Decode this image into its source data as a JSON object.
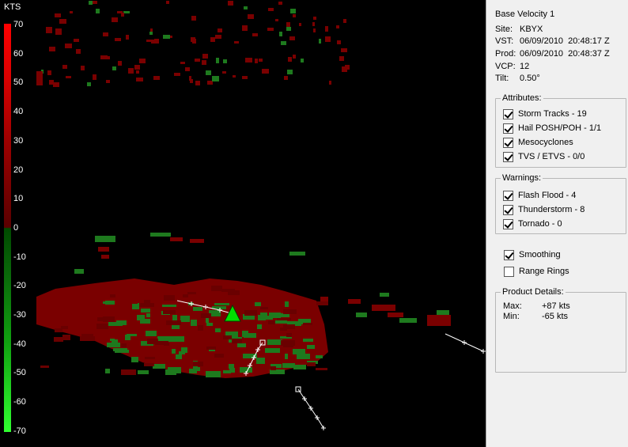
{
  "colors": {
    "velocity_outbound": "#7a0000",
    "velocity_inbound": "#1e7a1e",
    "storm_marker": "#00e000",
    "track": "#ffffff",
    "panel_bg": "#f0f0f0"
  },
  "scale": {
    "unit": "KTS",
    "ticks": [
      "70",
      "60",
      "50",
      "40",
      "30",
      "20",
      "10",
      "0",
      "-10",
      "-20",
      "-30",
      "-40",
      "-50",
      "-60",
      "-70"
    ]
  },
  "product": {
    "name": "Base Velocity 1",
    "site_label": "Site:",
    "site": "KBYX",
    "vst_label": "VST:",
    "vst": "06/09/2010  20:48:17 Z",
    "prod_label": "Prod:",
    "prod": "06/09/2010  20:48:37 Z",
    "vcp_label": "VCP:",
    "vcp": "12",
    "tilt_label": "Tilt:",
    "tilt": "0.50°"
  },
  "attributes": {
    "title": "Attributes:",
    "items": [
      {
        "label": "Storm Tracks - 19",
        "checked": true
      },
      {
        "label": "Hail POSH/POH - 1/1",
        "checked": true
      },
      {
        "label": "Mesocyclones",
        "checked": true
      },
      {
        "label": "TVS / ETVS - 0/0",
        "checked": true
      }
    ]
  },
  "warnings": {
    "title": "Warnings:",
    "items": [
      {
        "label": "Flash Flood - 4",
        "checked": true
      },
      {
        "label": "Thunderstorm - 8",
        "checked": true
      },
      {
        "label": "Tornado - 0",
        "checked": true
      }
    ]
  },
  "options": {
    "smoothing": {
      "label": "Smoothing",
      "checked": true
    },
    "range_rings": {
      "label": "Range Rings",
      "checked": false
    }
  },
  "details": {
    "title": "Product Details:",
    "max_label": "Max:",
    "max": "+87 kts",
    "min_label": "Min:",
    "min": "-65 kts"
  }
}
